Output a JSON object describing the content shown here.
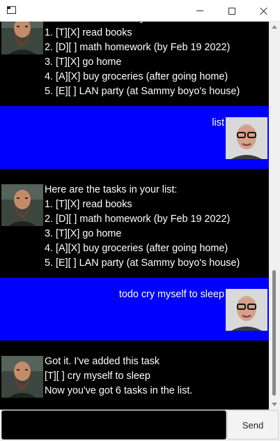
{
  "window": {
    "minimize_icon": "minimize-icon",
    "maximize_icon": "maximize-icon",
    "close_icon": "close-icon"
  },
  "colors": {
    "chat_background": "#000000",
    "user_bubble": "#0000ff",
    "text": "#ffffff"
  },
  "messages": [
    {
      "sender": "bot",
      "avatar": "bearded-man-avatar",
      "text": "Here are the tasks in your list:\n1. [T][X] read books\n2. [D][ ] math homework (by Feb 19 2022)\n3. [T][X] go home\n4. [A][X] buy groceries (after going home)\n5. [E][ ] LAN party (at Sammy boyo's house)"
    },
    {
      "sender": "user",
      "avatar": "glasses-man-avatar",
      "text": "list"
    },
    {
      "sender": "bot",
      "avatar": "bearded-man-avatar",
      "text": "Here are the tasks in your list:\n1. [T][X] read books\n2. [D][ ] math homework (by Feb 19 2022)\n3. [T][X] go home\n4. [A][X] buy groceries (after going home)\n5. [E][ ] LAN party (at Sammy boyo's house)"
    },
    {
      "sender": "user",
      "avatar": "glasses-man-avatar",
      "text": "todo cry myself to sleep"
    },
    {
      "sender": "bot",
      "avatar": "bearded-man-avatar",
      "text": "Got it. I've added this task\n[T][ ] cry myself to sleep\nNow you've got 6 tasks in the list."
    }
  ],
  "input": {
    "value": "",
    "placeholder": ""
  },
  "send_button": {
    "label": "Send"
  }
}
